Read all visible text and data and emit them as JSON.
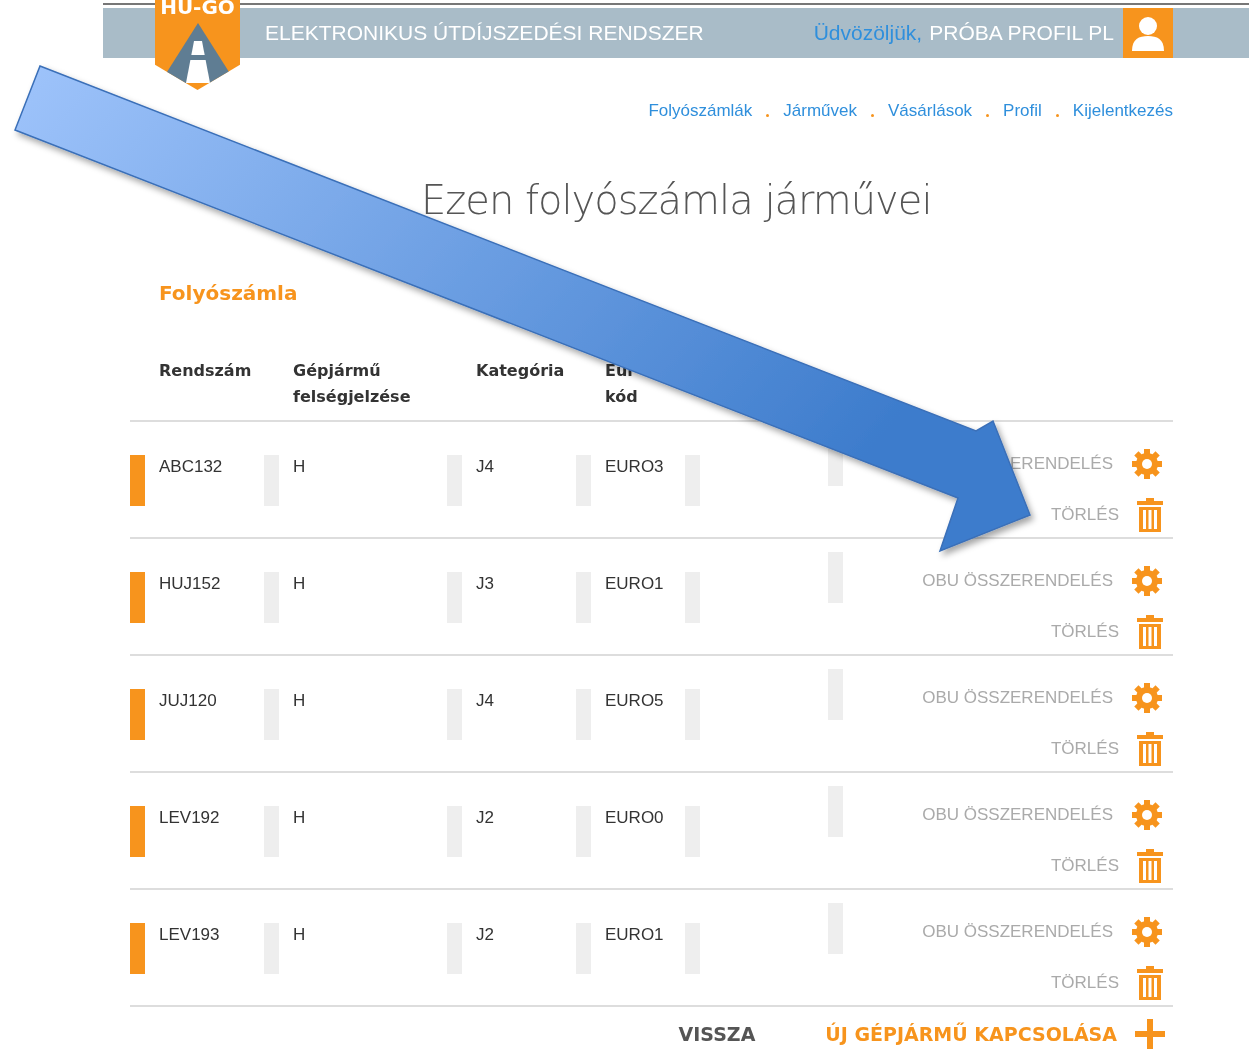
{
  "header": {
    "logo_text": "HU-GO",
    "title": "ELEKTRONIKUS ÚTDÍJSZEDÉSI RENDSZER",
    "greeting": "Üdvözöljük,",
    "user": "PRÓBA PROFIL PL"
  },
  "nav": [
    "Folyószámlák",
    "Járművek",
    "Vásárlások",
    "Profil",
    "Kijelentkezés"
  ],
  "page_title": "Ezen folyószámla járművei",
  "section_title": "Folyószámla",
  "table": {
    "columns": [
      [
        "Rendszám"
      ],
      [
        "Gépjármű",
        "felségjelzése"
      ],
      [
        "Kategória"
      ],
      [
        "Eur",
        "kód"
      ]
    ],
    "rows": [
      {
        "plate": "ABC132",
        "country": "H",
        "category": "J4",
        "euro": "EURO3",
        "obu_label": "ERENDELÉS",
        "delete_label": "TÖRLÉS"
      },
      {
        "plate": "HUJ152",
        "country": "H",
        "category": "J3",
        "euro": "EURO1",
        "obu_label": "OBU ÖSSZERENDELÉS",
        "delete_label": "TÖRLÉS"
      },
      {
        "plate": "JUJ120",
        "country": "H",
        "category": "J4",
        "euro": "EURO5",
        "obu_label": "OBU ÖSSZERENDELÉS",
        "delete_label": "TÖRLÉS"
      },
      {
        "plate": "LEV192",
        "country": "H",
        "category": "J2",
        "euro": "EURO0",
        "obu_label": "OBU ÖSSZERENDELÉS",
        "delete_label": "TÖRLÉS"
      },
      {
        "plate": "LEV193",
        "country": "H",
        "category": "J2",
        "euro": "EURO1",
        "obu_label": "OBU ÖSSZERENDELÉS",
        "delete_label": "TÖRLÉS"
      }
    ]
  },
  "footer": {
    "back": "VISSZA",
    "add": "ÚJ GÉPJÁRMŰ KAPCSOLÁSA"
  }
}
